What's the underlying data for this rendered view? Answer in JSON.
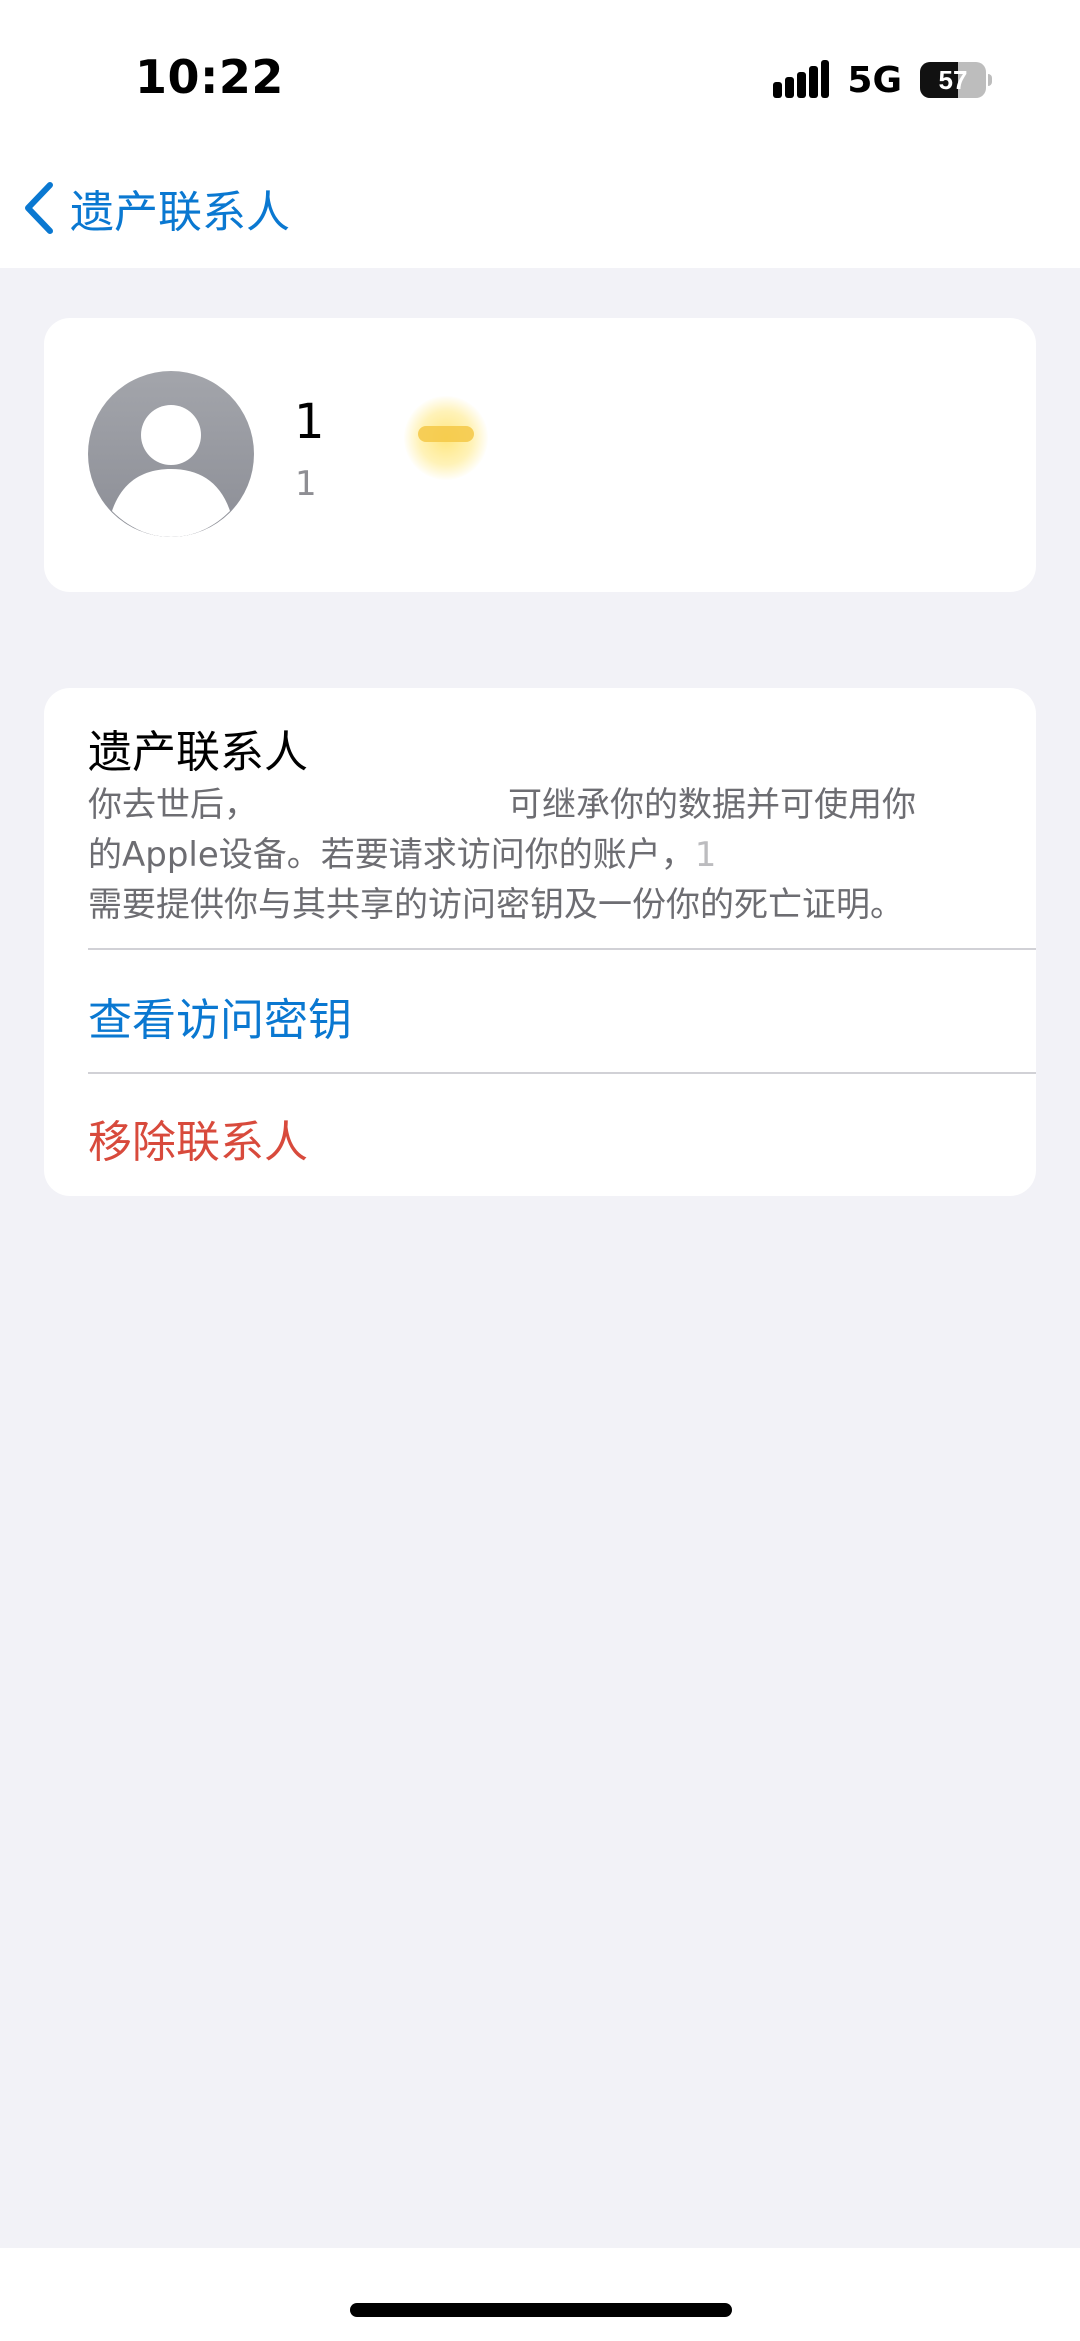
{
  "status_bar": {
    "time": "10:22",
    "network": "5G",
    "battery_level": "57",
    "battery_fraction": 0.57,
    "icons": [
      "signal-bars-icon",
      "battery-icon"
    ]
  },
  "nav": {
    "back_label": "遗产联系人",
    "back_icon": "chevron-left-icon"
  },
  "contact": {
    "name": "1",
    "detail": "1",
    "avatar_icon": "person-silhouette-icon"
  },
  "legacy_section": {
    "title": "遗产联系人",
    "description_lines": [
      "你去世后，",
      "可继承你的数据并可使用你",
      "的Apple设备。若要请求访问你的账户，",
      "1",
      "需要提供你与其共享的访问密钥及一份你的死亡证明。"
    ],
    "view_key_label": "查看访问密钥",
    "remove_label": "移除联系人"
  },
  "colors": {
    "accent_blue": "#0a78d1",
    "destructive_red": "#d84a3c",
    "secondary_text": "#6d6d72",
    "background": "#f2f2f7"
  }
}
